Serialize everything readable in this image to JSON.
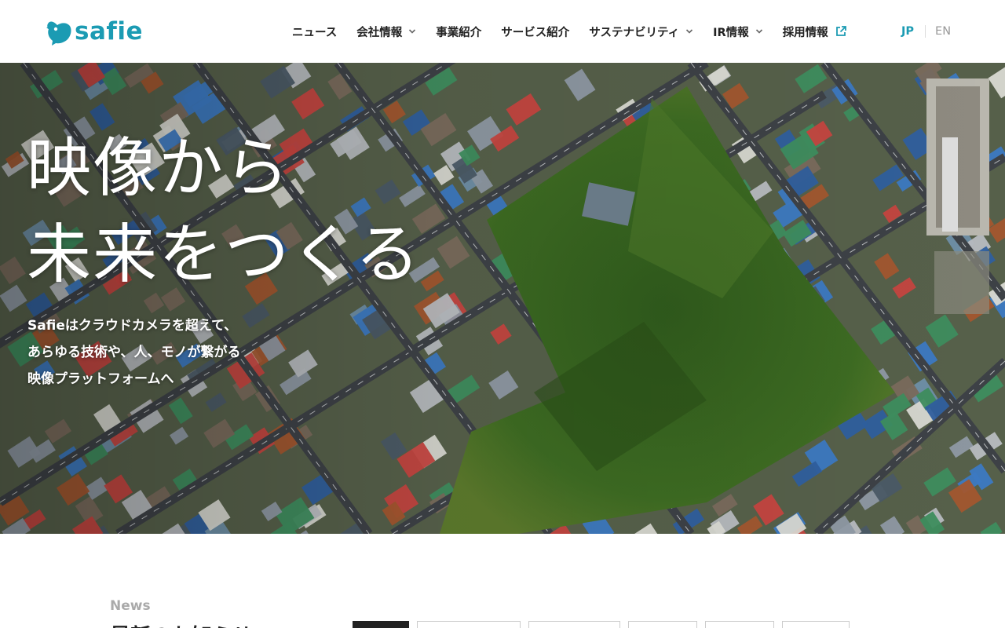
{
  "header": {
    "logo_text": "safie",
    "nav": [
      {
        "label": "ニュース",
        "dropdown": false,
        "external": false
      },
      {
        "label": "会社情報",
        "dropdown": true,
        "external": false
      },
      {
        "label": "事業紹介",
        "dropdown": false,
        "external": false
      },
      {
        "label": "サービス紹介",
        "dropdown": false,
        "external": false
      },
      {
        "label": "サステナビリティ",
        "dropdown": true,
        "external": false
      },
      {
        "label": "IR情報",
        "dropdown": true,
        "external": false
      },
      {
        "label": "採用情報",
        "dropdown": false,
        "external": true
      }
    ],
    "lang": {
      "current": "JP",
      "other": "EN"
    }
  },
  "hero": {
    "title_line1": "映像から",
    "title_line2": "未来をつくる",
    "subtitle_line1": "Safieはクラウドカメラを超えて、",
    "subtitle_line2": "あらゆる技術や、人、モノが繋がる",
    "subtitle_line3": "映像プラットフォームへ"
  },
  "news": {
    "label": "News",
    "heading": "最新のお知らせ"
  },
  "colors": {
    "brand": "#1b9bb3",
    "text": "#222222",
    "muted": "#aaaaaa"
  }
}
